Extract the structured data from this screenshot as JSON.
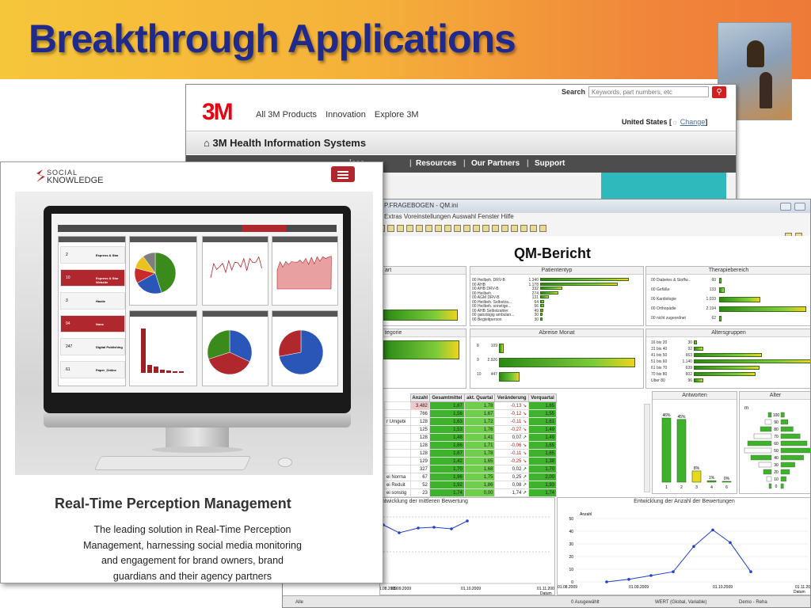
{
  "slide": {
    "title": "Breakthrough Applications"
  },
  "site3m": {
    "search_label": "Search",
    "search_placeholder": "Keywords, part numbers, etc",
    "logo": "3M",
    "nav": [
      "All 3M Products",
      "Innovation",
      "Explore 3M"
    ],
    "country": "United States",
    "change_label": "Change",
    "section_title": "3M Health Information Systems",
    "menu": [
      "ices",
      "Resources",
      "Our Partners",
      "Support"
    ]
  },
  "qm": {
    "window_title": "P.FRAGEBOGEN - QM.ini",
    "menu": "Extras  Voreinstellungen  Auswahl  Fenster  Hilfe",
    "heading": "QM-Bericht",
    "panels": {
      "p1": "art",
      "patiententyp": "Patiententyp",
      "therapie": "Therapiebereich",
      "kategorie": "tegorie",
      "abreise": "Abreise Monat",
      "alters": "Altersgruppen",
      "antworten": "Antworten",
      "alter": "Alter",
      "entw_mittel": "ntwicklung der mittleren Bewertung",
      "entw_anzahl": "Entwicklung der Anzahl der Bewertungen"
    },
    "patiententyp_rows": [
      {
        "label": "00 Heilbeh. DRV-B",
        "value": "1.340"
      },
      {
        "label": "00 AHB",
        "value": "1.178"
      },
      {
        "label": "00 AHB DRV-B",
        "value": "332"
      },
      {
        "label": "00 Heilbeh.",
        "value": "274"
      },
      {
        "label": "00 AGM DRV-B",
        "value": "131"
      },
      {
        "label": "00 Heilbeh. Selbstza...",
        "value": "64"
      },
      {
        "label": "00 Heilbeh. sonstige...",
        "value": "56"
      },
      {
        "label": "00 AHB Selbstzahler",
        "value": "49"
      },
      {
        "label": "00 ganztägig ambulan...",
        "value": "30"
      },
      {
        "label": "00 Begleitperson",
        "value": "30"
      }
    ],
    "therapie_rows": [
      {
        "label": "00 Diabetes & Stoffw...",
        "value": "60"
      },
      {
        "label": "00 Gefäße",
        "value": "133"
      },
      {
        "label": "00 Kardiologie",
        "value": "1.033"
      },
      {
        "label": "00 Orthopädie",
        "value": "2.194"
      },
      {
        "label": "00 nicht zugeordnet",
        "value": "62"
      }
    ],
    "abreise_rows": [
      {
        "label": "8",
        "value": "109"
      },
      {
        "label": "9",
        "value": "2.926"
      },
      {
        "label": "10",
        "value": "447"
      }
    ],
    "alters_rows": [
      {
        "label": "16 bis 20",
        "value": "30"
      },
      {
        "label": "31 bis 40",
        "value": "92"
      },
      {
        "label": "41 bis 50",
        "value": "663"
      },
      {
        "label": "51 bis 60",
        "value": "1.140"
      },
      {
        "label": "61 bis 70",
        "value": "639"
      },
      {
        "label": "70 bis 80",
        "value": "602"
      },
      {
        "label": "Über 80",
        "value": "96"
      }
    ],
    "table_headers": [
      "Anzahl",
      "Gesamtmittel",
      "akt. Quartal",
      "Veränderung",
      "Vorquartal"
    ],
    "table_rows": [
      {
        "label": "",
        "anzahl": "3.482",
        "gesamt": "1,67",
        "akt": "1,78",
        "ver": "-0,13",
        "vor": "1,65"
      },
      {
        "label": "",
        "anzahl": "766",
        "gesamt": "1,56",
        "akt": "1,67",
        "ver": "-0,12",
        "vor": "1,55"
      },
      {
        "label": "r Umgebi",
        "anzahl": "128",
        "gesamt": "1,63",
        "akt": "1,72",
        "ver": "-0,11",
        "vor": "1,61"
      },
      {
        "label": "",
        "anzahl": "125",
        "gesamt": "1,53",
        "akt": "1,76",
        "ver": "-0,27",
        "vor": "1,49"
      },
      {
        "label": "",
        "anzahl": "128",
        "gesamt": "1,48",
        "akt": "1,41",
        "ver": "0,07",
        "vor": "1,49"
      },
      {
        "label": "",
        "anzahl": "128",
        "gesamt": "1,66",
        "akt": "1,71",
        "ver": "-0,06",
        "vor": "1,65"
      },
      {
        "label": "",
        "anzahl": "128",
        "gesamt": "1,67",
        "akt": "1,78",
        "ver": "-0,11",
        "vor": "1,65"
      },
      {
        "label": "",
        "anzahl": "129",
        "gesamt": "1,42",
        "akt": "1,65",
        "ver": "-0,25",
        "vor": "1,38"
      },
      {
        "label": "",
        "anzahl": "327",
        "gesamt": "1,70",
        "akt": "1,68",
        "ver": "0,02",
        "vor": "1,70"
      },
      {
        "label": "ei Norma",
        "anzahl": "67",
        "gesamt": "1,96",
        "akt": "1,75",
        "ver": "0,25",
        "vor": "2,00"
      },
      {
        "label": "ei Reduit",
        "anzahl": "52",
        "gesamt": "1,92",
        "akt": "1,86",
        "ver": "0,08",
        "vor": "1,93"
      },
      {
        "label": "ei sonstig",
        "anzahl": "23",
        "gesamt": "1,74",
        "akt": "0,00",
        "ver": "1,74",
        "vor": "1,74"
      }
    ],
    "antworten_labels": [
      "46%",
      "45%",
      "8%",
      "1%",
      "0%"
    ],
    "antworten_x": [
      "1",
      "2",
      "3",
      "4",
      "6"
    ],
    "alter_labels": [
      "100",
      "90",
      "80",
      "70",
      "60",
      "50",
      "40",
      "30",
      "20",
      "10",
      "0"
    ],
    "alter_m": "m",
    "chart_left_x": [
      "01.08.2009",
      "01.09.2009",
      "01.10.2009",
      "01.11.2009"
    ],
    "chart_left_xlabel": "Datum",
    "chart_right_x": [
      "01.08.2009",
      "01.09.2009",
      "01.10.2009",
      "01.11.2009"
    ],
    "chart_right_xlabel": "Datum",
    "chart_right_ylabel": "Anzahl",
    "chart_right_y": [
      "50",
      "40",
      "30",
      "20",
      "10",
      "0"
    ],
    "status": [
      "Alle",
      "0 Ausgewählt",
      "WERT (Global, Variable)",
      "Demo - Reha"
    ]
  },
  "social": {
    "logo_line1": "SOCIAL",
    "logo_line2": "KNOWLEDGE",
    "screen_list": [
      {
        "num": "2",
        "label": "Express & Star"
      },
      {
        "num": "10",
        "label": "Express & Star Website"
      },
      {
        "num": "3",
        "label": "Hastie"
      },
      {
        "num": "94",
        "label": "Nana"
      },
      {
        "num": "247",
        "label": "Digital Publishing"
      },
      {
        "num": "61",
        "label": "Paper_Online"
      }
    ],
    "headline": "Real-Time Perception Management",
    "description": "The leading solution in Real-Time Perception Management, harnessing social media monitoring and engagement for brand owners, brand guardians and their agency partners"
  }
}
